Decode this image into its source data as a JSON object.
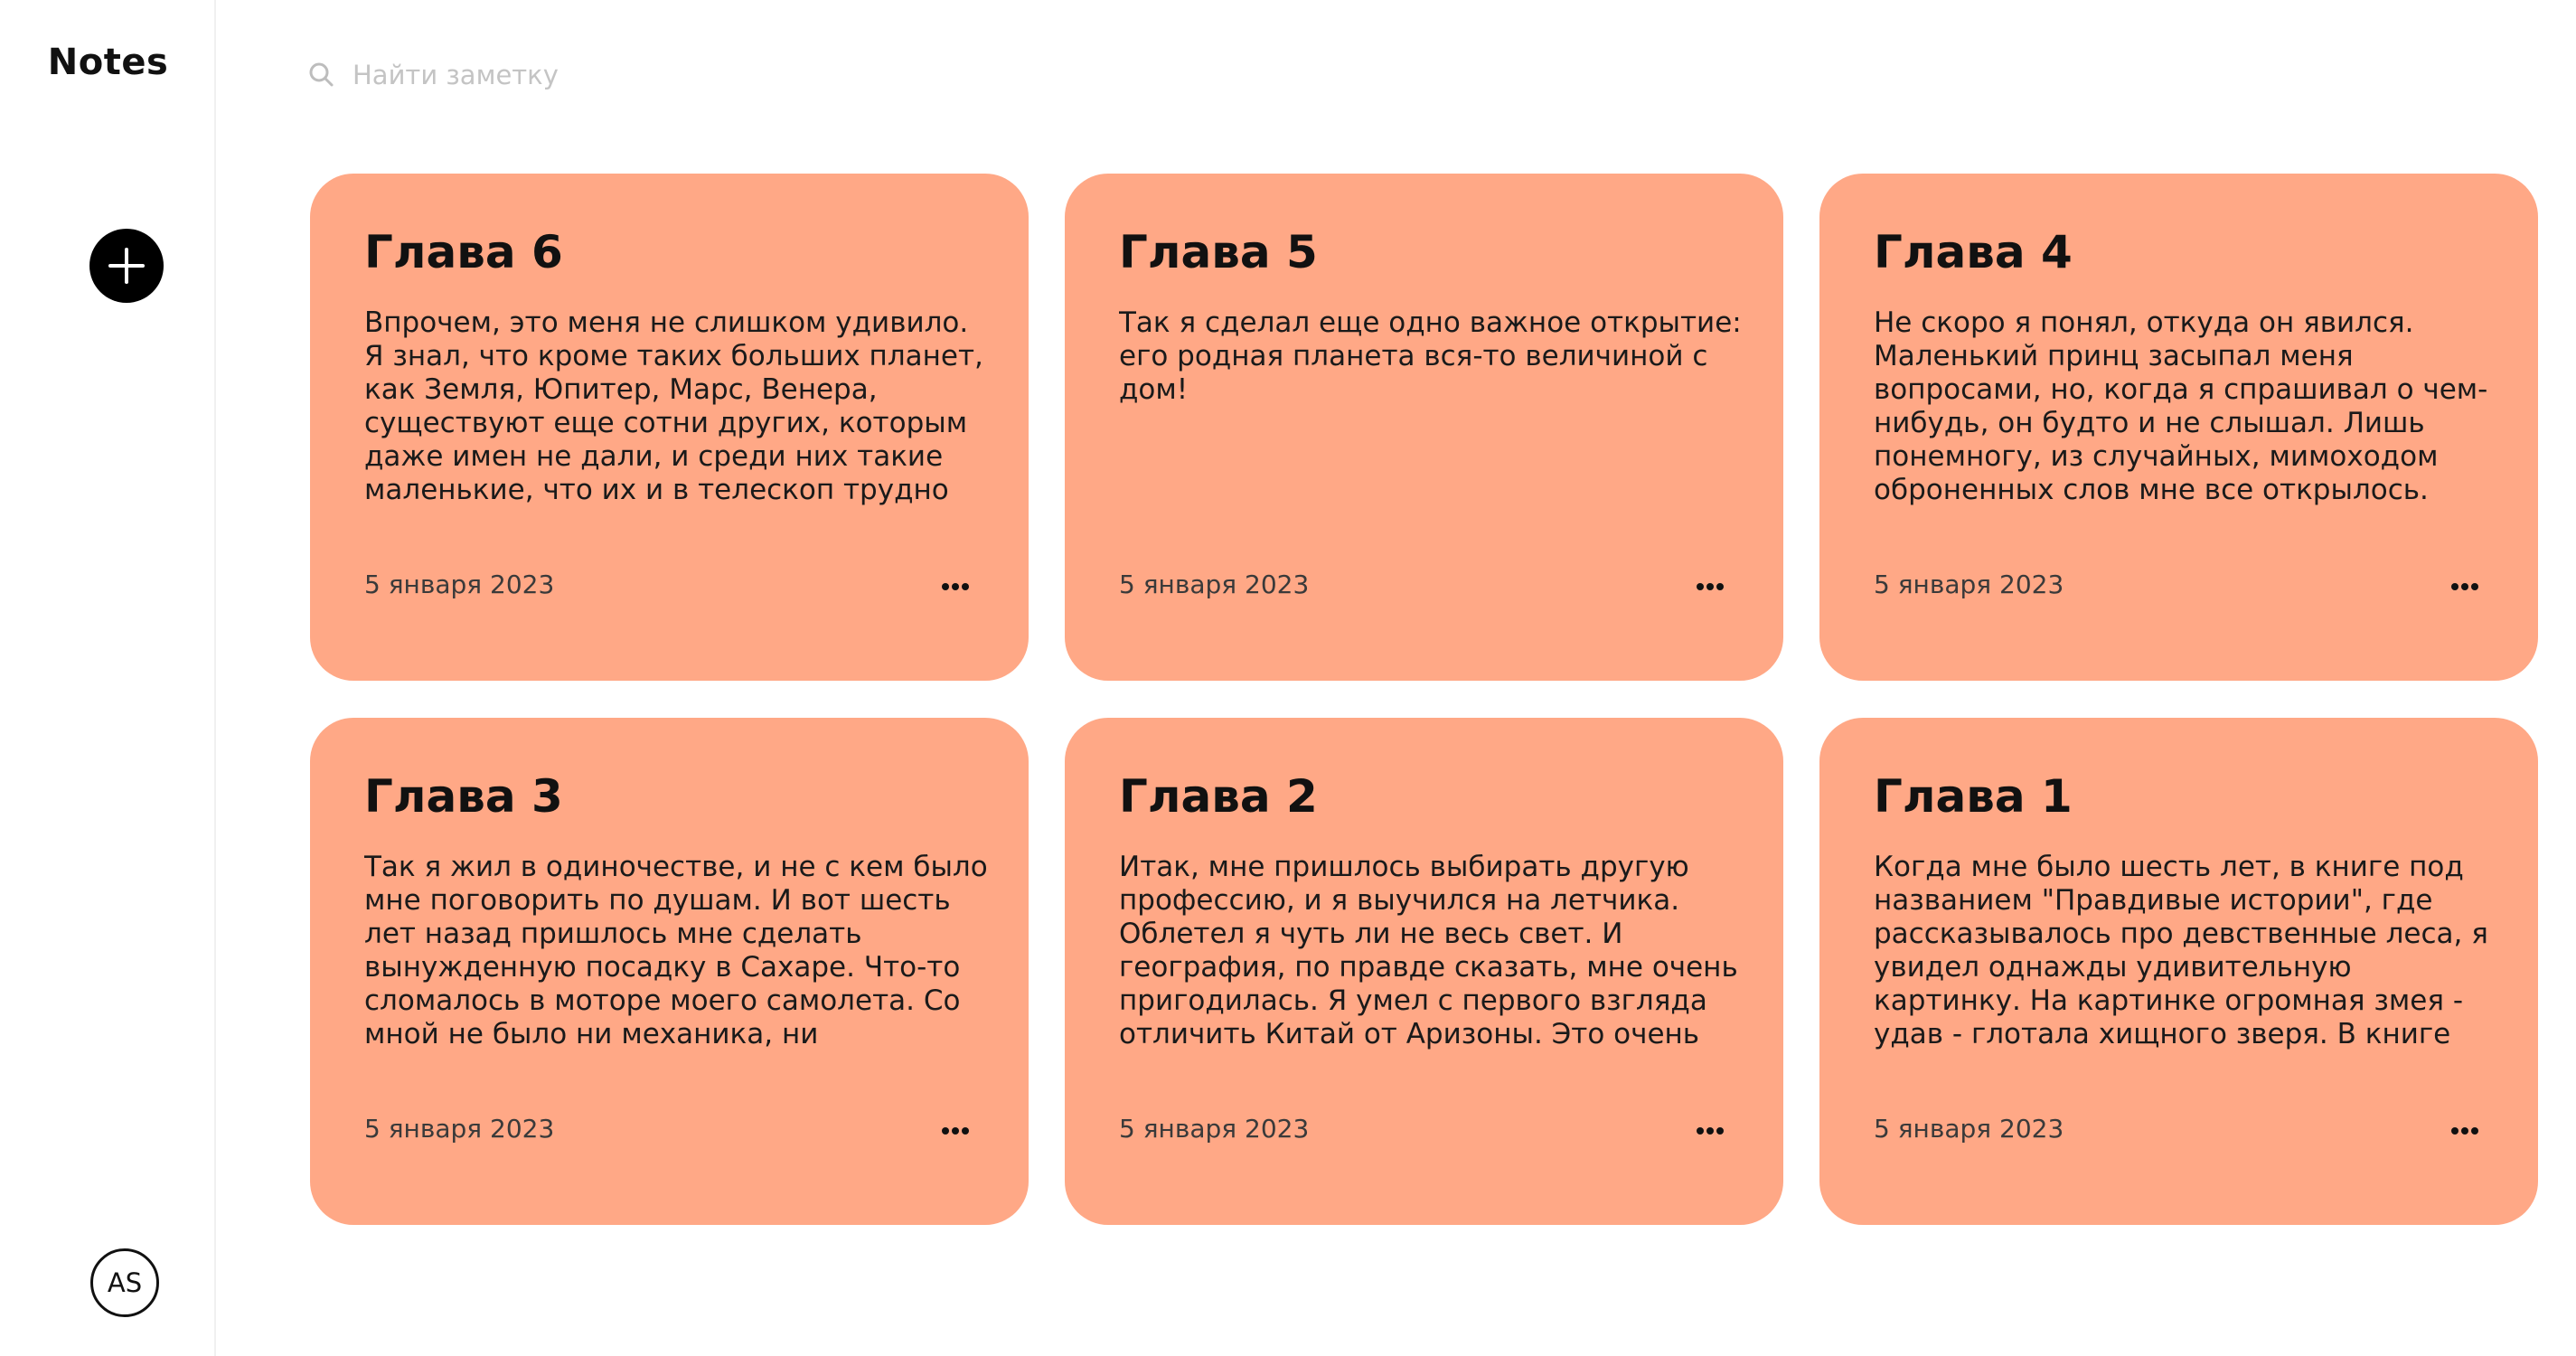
{
  "sidebar": {
    "title": "Notes",
    "add_icon": "plus-icon",
    "avatar_initials": "AS"
  },
  "search": {
    "icon": "search-icon",
    "placeholder": "Найти заметку",
    "value": ""
  },
  "colors": {
    "card_background": "#FFA886",
    "accent": "#000000"
  },
  "notes": [
    {
      "title": "Глава 6",
      "text": "Впрочем, это меня не слишком удивило. Я знал, что кроме таких больших планет, как Земля, Юпитер, Марс, Венера, существуют еще сотни других, которым даже имен не дали, и среди них такие маленькие, что их и в телескоп трудно разглядеть. Когда",
      "date": "5 января 2023",
      "menu_icon": "more-horizontal-icon"
    },
    {
      "title": "Глава 5",
      "text": "Так я сделал еще одно важное открытие: его родная планета вся-то величиной с дом!",
      "date": "5 января 2023",
      "menu_icon": "more-horizontal-icon"
    },
    {
      "title": "Глава 4",
      "text": "Не скоро я понял, откуда он явился. Маленький принц засыпал меня вопросами, но, когда я спрашивал о чем-нибудь, он будто и не слышал. Лишь понемногу, из случайных, мимоходом оброненных слов мне все открылось. Так,",
      "date": "5 января 2023",
      "menu_icon": "more-horizontal-icon"
    },
    {
      "title": "Глава 3",
      "text": "Так я жил в одиночестве, и не с кем было мне поговорить по душам. И вот шесть лет назад пришлось мне сделать вынужденную посадку в Сахаре. Что-то сломалось в моторе моего самолета. Со мной не было ни механика, ни",
      "date": "5 января 2023",
      "menu_icon": "more-horizontal-icon"
    },
    {
      "title": "Глава 2",
      "text": "Итак, мне пришлось выбирать другую профессию, и я выучился на летчика. Облетел я чуть ли не весь свет. И география, по правде сказать, мне очень пригодилась. Я умел с первого взгляда отличить Китай от Аризоны. Это очень",
      "date": "5 января 2023",
      "menu_icon": "more-horizontal-icon"
    },
    {
      "title": "Глава 1",
      "text": "Когда мне было шесть лет, в книге под названием \"Правдивые истории\", где рассказывалось про девственные леса, я увидел однажды удивительную картинку. На картинке огромная змея - удав - глотала хищного зверя. В книге",
      "date": "5 января 2023",
      "menu_icon": "more-horizontal-icon"
    }
  ]
}
